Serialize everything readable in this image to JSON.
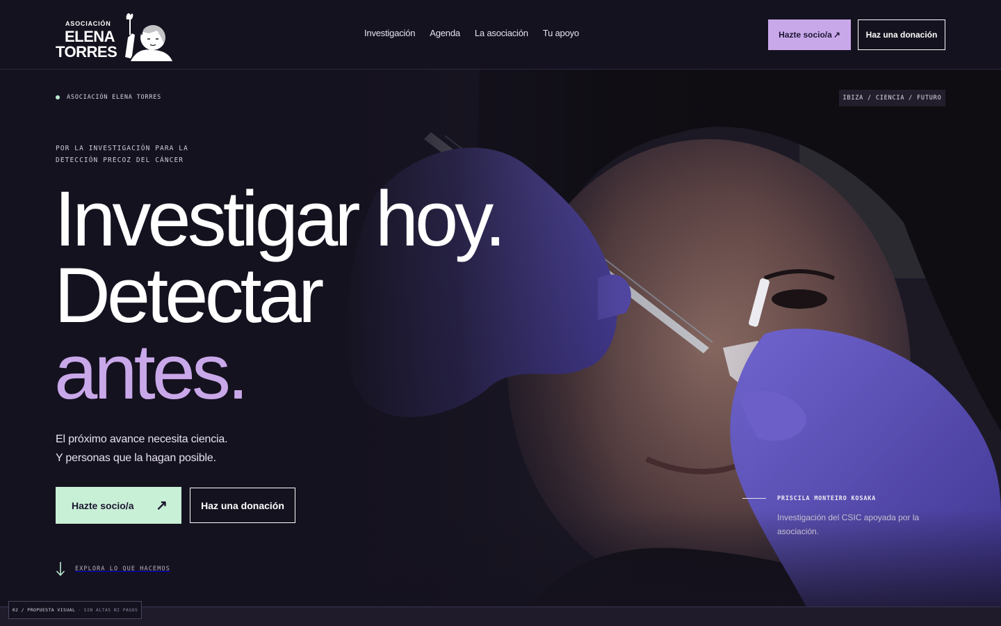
{
  "brand": {
    "logo_small": "ASOCIACIÓN",
    "logo_line1": "ELENA",
    "logo_line2": "TORRES"
  },
  "nav": {
    "items": [
      {
        "label": "Investigación"
      },
      {
        "label": "Agenda"
      },
      {
        "label": "La asociación"
      },
      {
        "label": "Tu apoyo"
      }
    ]
  },
  "header_actions": {
    "member_label": "Hazte socio/a",
    "member_arrow": "↗",
    "donate_label": "Haz una donación"
  },
  "hero": {
    "eyebrow": "ASOCIACIÓN ELENA TORRES",
    "tagline": "IBIZA / CIENCIA / FUTURO",
    "kicker_line1": "POR LA INVESTIGACIÓN PARA LA",
    "kicker_line2": "DETECCIÓN PRECOZ DEL CÁNCER",
    "headline_line1": "Investigar hoy.",
    "headline_line2": "Detectar",
    "headline_line3": "antes.",
    "lede_line1": "El próximo avance necesita ciencia.",
    "lede_line2": "Y personas que la hagan posible.",
    "cta_member": "Hazte socio/a",
    "cta_member_arrow": "↗",
    "cta_donate": "Haz una donación",
    "explore": "EXPLORA LO QUE HACEMOS",
    "caption_name": "PRISCILA MONTEIRO KOSAKA",
    "caption_desc": "Investigación del CSIC apoyada por la asociación."
  },
  "footer_badge": {
    "label": "02 / PROPUESTA VISUAL",
    "sep": "·",
    "note": "SIN ALTAS NI PAGOS"
  },
  "colors": {
    "background": "#15121f",
    "accent_lilac": "#c9a8ea",
    "accent_mint": "#c8f0d6",
    "glove_purple": "#5b4fb8"
  },
  "icons": {
    "logo_art": "girl-portrait-logo",
    "down_arrow": "arrow-down-icon",
    "external": "arrow-up-right-icon"
  }
}
